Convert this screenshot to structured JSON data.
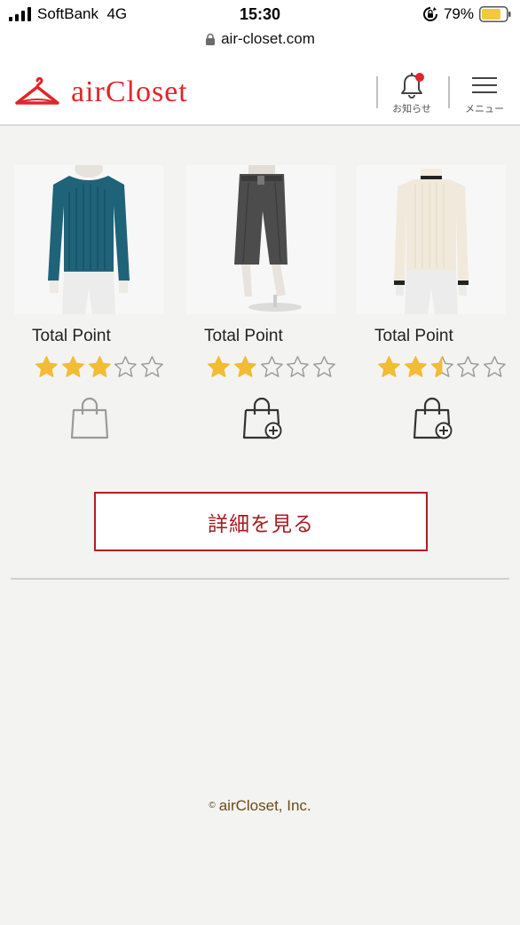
{
  "status_bar": {
    "carrier": "SoftBank",
    "network": "4G",
    "time": "15:30",
    "battery_percent": "79%",
    "battery_level": 0.79,
    "battery_color": "#f2c93a"
  },
  "browser": {
    "url": "air-closet.com"
  },
  "header": {
    "logo_text": "airCloset",
    "brand_color": "#e0262b",
    "notification_label": "お知らせ",
    "notification_badge_color": "#e0262b",
    "menu_label": "メニュー"
  },
  "products": [
    {
      "total_point_label": "Total Point",
      "rating": 3,
      "max_rating": 5,
      "garment": "teal-ribbed-sweater",
      "bag_icon": "shopping-bag-icon",
      "bag_added": true
    },
    {
      "total_point_label": "Total Point",
      "rating": 2,
      "max_rating": 5,
      "garment": "gray-wide-pants",
      "bag_icon": "shopping-bag-add-icon",
      "bag_added": false
    },
    {
      "total_point_label": "Total Point",
      "rating": 2.5,
      "max_rating": 5,
      "garment": "cream-turtleneck",
      "bag_icon": "shopping-bag-add-icon",
      "bag_added": false
    }
  ],
  "details_button": {
    "label": "詳細を見る",
    "accent_color": "#b31d24"
  },
  "footer": {
    "copyright_symbol": "©",
    "copyright_text": "airCloset, Inc."
  },
  "colors": {
    "star_filled": "#f2bc34",
    "star_empty_stroke": "#9a9a9a",
    "background": "#f3f3f1"
  }
}
